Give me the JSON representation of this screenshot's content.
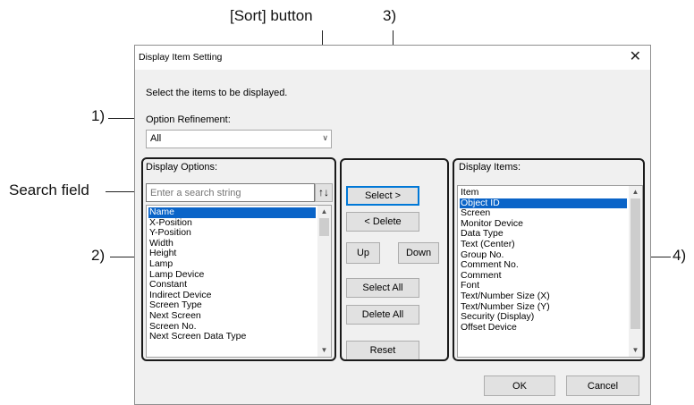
{
  "callouts": {
    "sort_button": "[Sort] button",
    "c1": "1)",
    "c2": "2)",
    "c3": "3)",
    "c4": "4)",
    "search_field": "Search field"
  },
  "dialog": {
    "title": "Display Item Setting",
    "close_glyph": "✕",
    "instruction": "Select the items to be displayed.",
    "option_refinement_label": "Option Refinement:",
    "option_refinement_value": "All",
    "display_options_label": "Display Options:",
    "search_placeholder": "Enter a search string",
    "sort_icon_glyph": "↑↓",
    "display_options": [
      "Name",
      "X-Position",
      "Y-Position",
      "Width",
      "Height",
      "Lamp",
      "Lamp Device",
      "Constant",
      "Indirect Device",
      "Screen Type",
      "Next Screen",
      "Screen No.",
      "Next Screen Data Type"
    ],
    "display_items_label": "Display Items:",
    "display_items": [
      "Item",
      "Object ID",
      "Screen",
      "Monitor Device",
      "Data Type",
      "Text (Center)",
      "Group No.",
      "Comment No.",
      "Comment",
      "Font",
      "Text/Number Size (X)",
      "Text/Number Size (Y)",
      "Security (Display)",
      "Offset Device"
    ],
    "buttons": {
      "select": "Select >",
      "delete": "< Delete",
      "up": "Up",
      "down": "Down",
      "select_all": "Select All",
      "delete_all": "Delete All",
      "reset": "Reset",
      "ok": "OK",
      "cancel": "Cancel"
    }
  },
  "colors": {
    "selection": "#0a64c8",
    "dialog_bg": "#f0f0f0",
    "default_button_border": "#0078d7"
  }
}
